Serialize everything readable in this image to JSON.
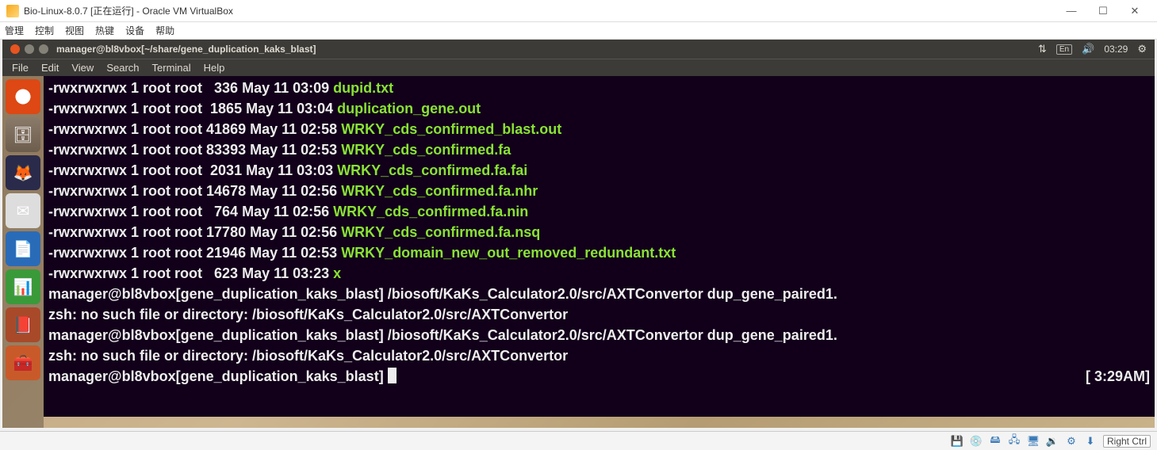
{
  "vbox": {
    "title": "Bio-Linux-8.0.7 [正在运行] - Oracle VM VirtualBox",
    "menu": [
      "管理",
      "控制",
      "视图",
      "热键",
      "设备",
      "帮助"
    ],
    "win_buttons": {
      "min": "—",
      "max": "☐",
      "close": "✕"
    },
    "host_key": "Right Ctrl",
    "status_icons": [
      "💾",
      "💿",
      "🖴",
      "🖧",
      "🖥",
      "🔉",
      "⚙",
      "⬇"
    ]
  },
  "ubuntu": {
    "panel_title": "manager@bl8vbox[~/share/gene_duplication_kaks_blast]",
    "lang": "En",
    "clock": "03:29",
    "tray_net": "⇅",
    "tray_sound": "🔊",
    "tray_gear": "⚙"
  },
  "term_menu": [
    "File",
    "Edit",
    "View",
    "Search",
    "Terminal",
    "Help"
  ],
  "launcher": [
    {
      "name": "ubuntu-dash",
      "glyph": "◉"
    },
    {
      "name": "files",
      "glyph": "🗄"
    },
    {
      "name": "firefox",
      "glyph": "🦊"
    },
    {
      "name": "mail",
      "glyph": "✉"
    },
    {
      "name": "writer",
      "glyph": "📄"
    },
    {
      "name": "calc",
      "glyph": "📊"
    },
    {
      "name": "impress",
      "glyph": "📕"
    },
    {
      "name": "other",
      "glyph": "🧰"
    }
  ],
  "ls": [
    {
      "perm": "-rwxrwxrwx 1 root root   336 May 11 03:09 ",
      "name": "dupid.txt"
    },
    {
      "perm": "-rwxrwxrwx 1 root root  1865 May 11 03:04 ",
      "name": "duplication_gene.out"
    },
    {
      "perm": "-rwxrwxrwx 1 root root 41869 May 11 02:58 ",
      "name": "WRKY_cds_confirmed_blast.out"
    },
    {
      "perm": "-rwxrwxrwx 1 root root 83393 May 11 02:53 ",
      "name": "WRKY_cds_confirmed.fa"
    },
    {
      "perm": "-rwxrwxrwx 1 root root  2031 May 11 03:03 ",
      "name": "WRKY_cds_confirmed.fa.fai"
    },
    {
      "perm": "-rwxrwxrwx 1 root root 14678 May 11 02:56 ",
      "name": "WRKY_cds_confirmed.fa.nhr"
    },
    {
      "perm": "-rwxrwxrwx 1 root root   764 May 11 02:56 ",
      "name": "WRKY_cds_confirmed.fa.nin"
    },
    {
      "perm": "-rwxrwxrwx 1 root root 17780 May 11 02:56 ",
      "name": "WRKY_cds_confirmed.fa.nsq"
    },
    {
      "perm": "-rwxrwxrwx 1 root root 21946 May 11 02:53 ",
      "name": "WRKY_domain_new_out_removed_redundant.txt"
    },
    {
      "perm": "-rwxrwxrwx 1 root root   623 May 11 03:23 ",
      "name": "x"
    }
  ],
  "cmds": [
    {
      "prompt": "manager@bl8vbox[gene_duplication_kaks_blast] ",
      "cmd": "/biosoft/KaKs_Calculator2.0/src/AXTConvertor dup_gene_paired1."
    },
    {
      "err": "zsh: no such file or directory: /biosoft/KaKs_Calculator2.0/src/AXTConvertor"
    },
    {
      "prompt": "manager@bl8vbox[gene_duplication_kaks_blast] ",
      "cmd": "/biosoft/KaKs_Calculator2.0/src/AXTConvertor dup_gene_paired1."
    },
    {
      "err": "zsh: no such file or directory: /biosoft/KaKs_Calculator2.0/src/AXTConvertor"
    }
  ],
  "final_prompt": "manager@bl8vbox[gene_duplication_kaks_blast] ",
  "right_time": "[ 3:29AM]"
}
